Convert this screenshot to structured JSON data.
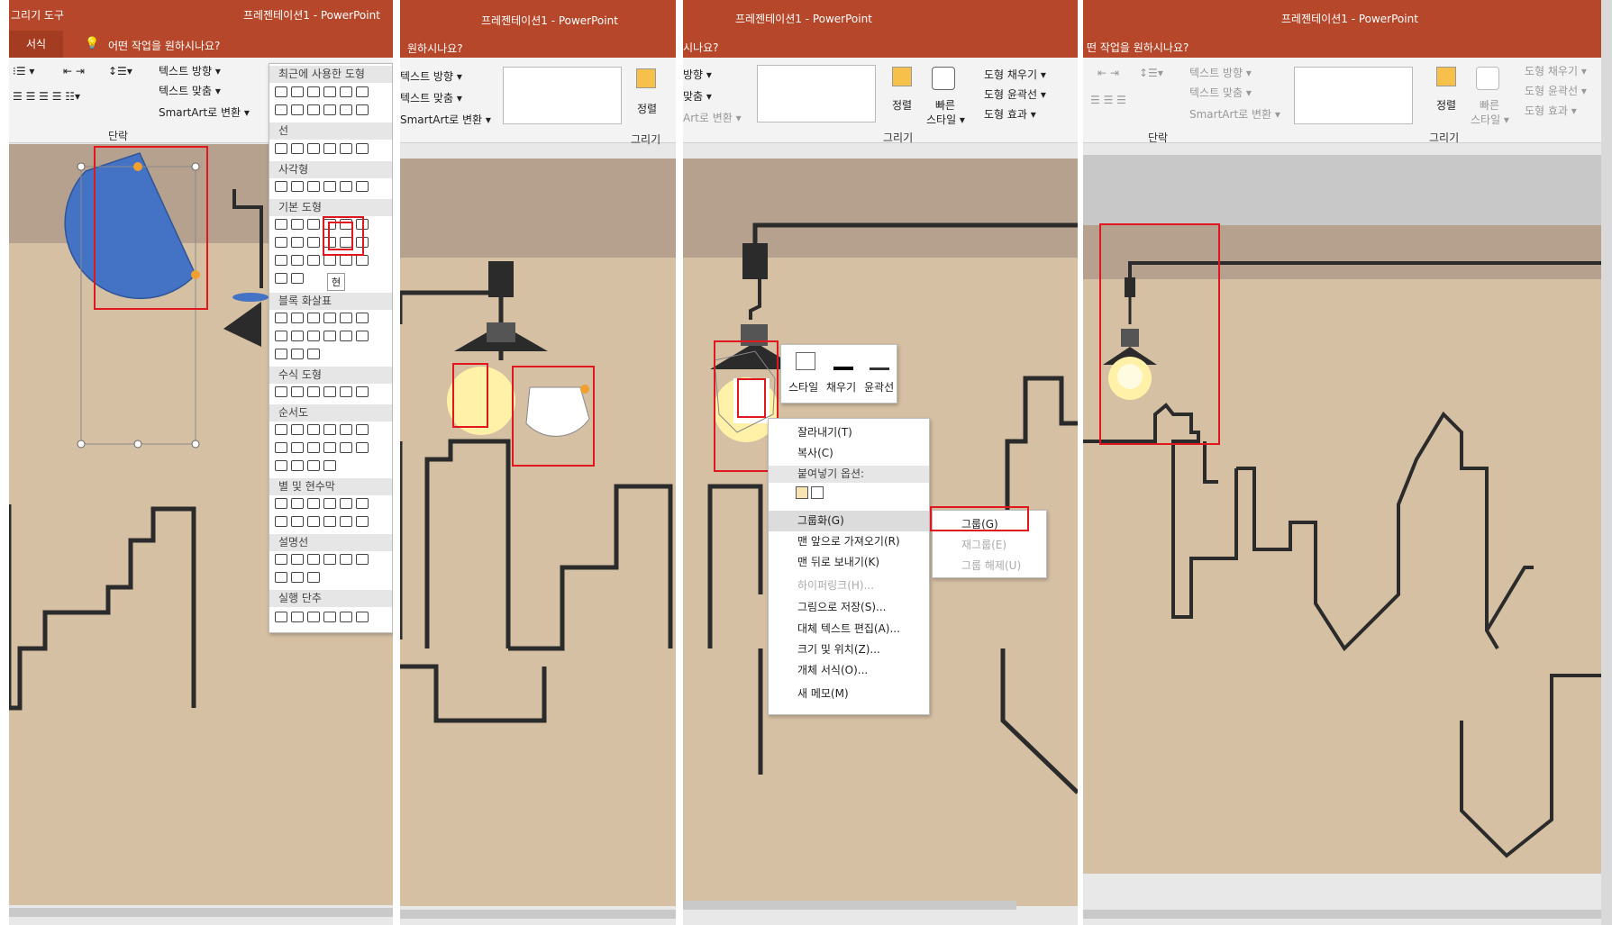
{
  "app_title": "프레젠테이션1  -  PowerPoint",
  "p1": {
    "contextual_tab": "그리기 도구",
    "tab_format": "서식",
    "tell_me": "어떤 작업을 원하시나요?",
    "text_direction": "텍스트 방향 ▾",
    "align_text": "텍스트 맞춤 ▾",
    "smartart": "SmartArt로 변환 ▾",
    "paragraph_group": "단락",
    "gallery": {
      "recent": "최근에 사용한 도형",
      "lines": "선",
      "rect": "사각형",
      "basic": "기본 도형",
      "block_arrows": "블록 화살표",
      "equation": "수식 도형",
      "flowchart": "순서도",
      "stars": "별 및 현수막",
      "callouts": "설명선",
      "action": "실행 단추",
      "tooltip": "현"
    }
  },
  "p2": {
    "tell_me": "원하시나요?",
    "text_direction": "텍스트 방향 ▾",
    "align_text": "텍스트 맞춤 ▾",
    "smartart": "SmartArt로 변환 ▾",
    "arrange": "정렬",
    "draw_group": "그리기"
  },
  "p3": {
    "tell_me": "시나요?",
    "direction": "방향 ▾",
    "align": "맞춤 ▾",
    "smartart": "Art로 변환 ▾",
    "arrange": "정렬",
    "quick_style_1": "빠른",
    "quick_style_2": "스타일 ▾",
    "fill": "도형 채우기 ▾",
    "outline": "도형 윤곽선 ▾",
    "effects": "도형 효과 ▾",
    "draw_group": "그리기",
    "mini": {
      "style": "스타일",
      "fill": "채우기",
      "outline": "윤곽선"
    },
    "context_menu": {
      "cut": "잘라내기(T)",
      "copy": "복사(C)",
      "paste_header": "붙여넣기 옵션:",
      "group": "그룹화(G)",
      "bring_front": "맨 앞으로 가져오기(R)",
      "send_back": "맨 뒤로 보내기(K)",
      "hyperlink": "하이퍼링크(H)...",
      "save_picture": "그림으로 저장(S)...",
      "alt_text": "대체 텍스트 편집(A)...",
      "size_pos": "크기 및 위치(Z)...",
      "format_obj": "개체 서식(O)...",
      "new_comment": "새 메모(M)"
    },
    "submenu": {
      "group": "그룹(G)",
      "regroup": "재그룹(E)",
      "ungroup": "그룹 해제(U)"
    }
  },
  "p4": {
    "tell_me": "떤 작업을 원하시나요?",
    "text_direction": "텍스트 방향 ▾",
    "align_text": "텍스트 맞춤 ▾",
    "smartart": "SmartArt로 변환 ▾",
    "paragraph_group": "단락",
    "arrange": "정렬",
    "quick_style_1": "빠른",
    "quick_style_2": "스타일 ▾",
    "fill": "도형 채우기 ▾",
    "outline": "도형 윤곽선 ▾",
    "effects": "도형 효과 ▾",
    "draw_group": "그리기"
  },
  "colors": {
    "title_bar": "#b7472a",
    "slide_bg": "#d6c0a4",
    "slide_top": "#b5a18e",
    "highlight": "#e0171f",
    "shape_blue": "#4472c4",
    "lamp_glow": "#fff2a8"
  }
}
